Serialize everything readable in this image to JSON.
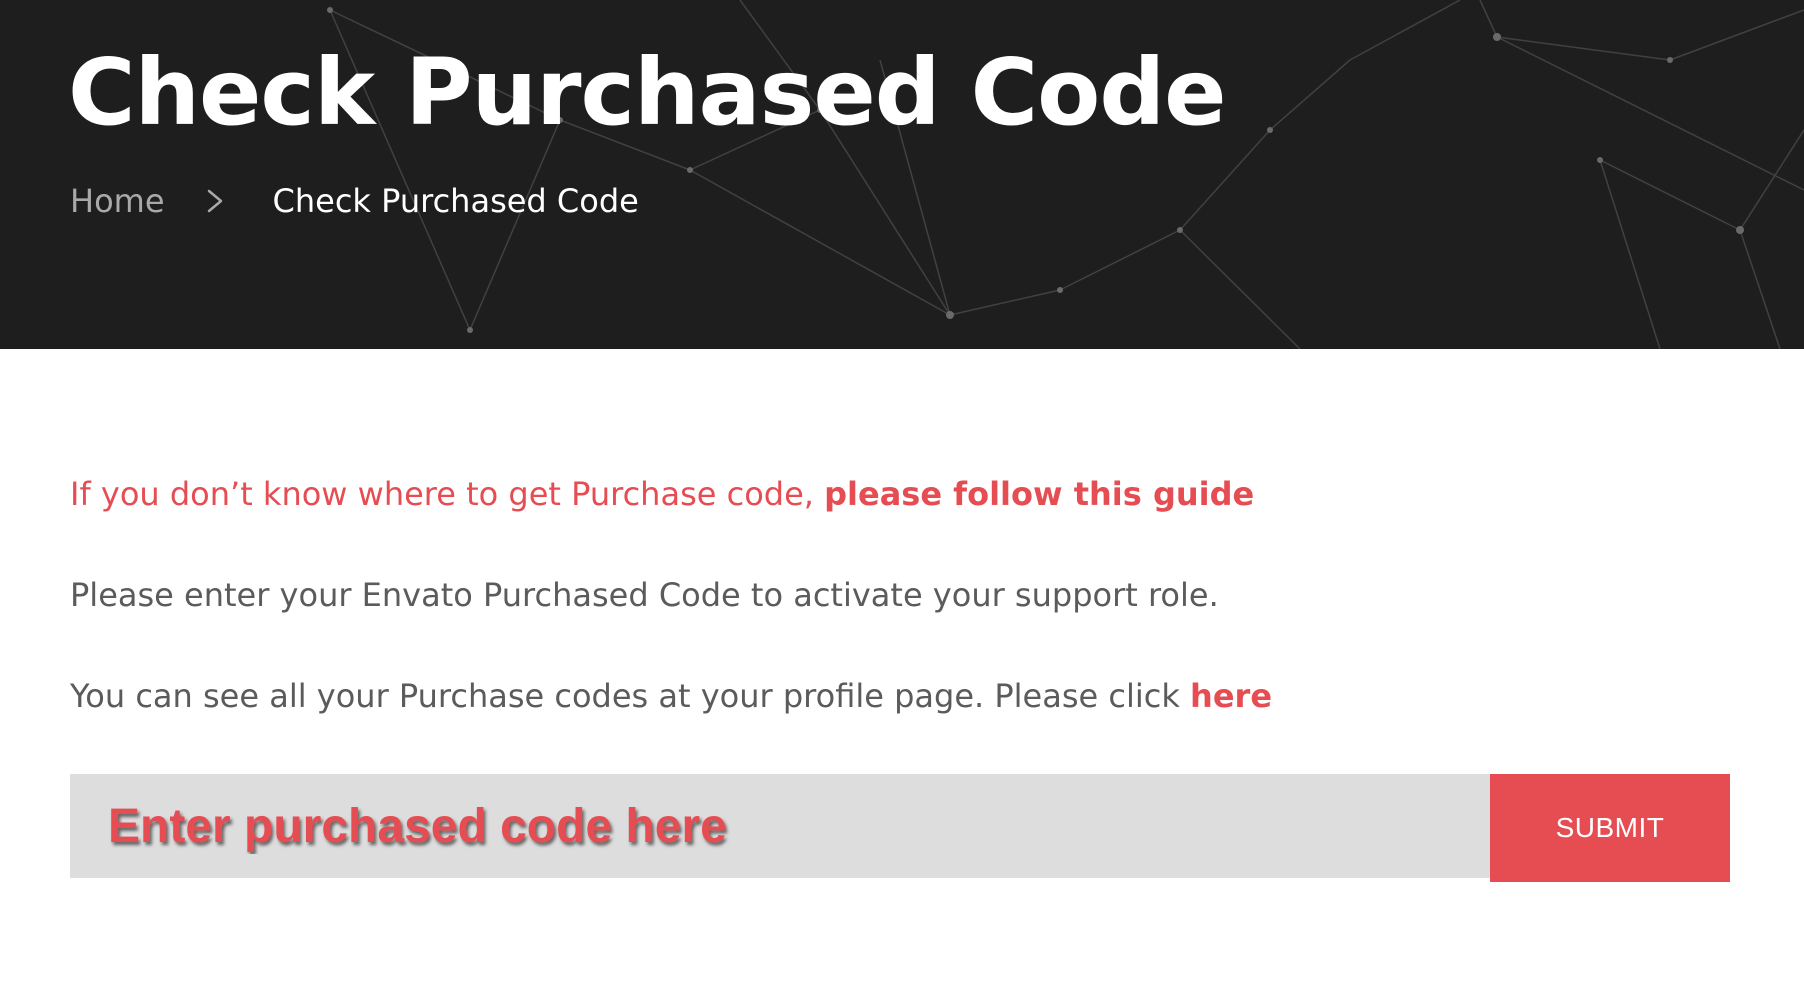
{
  "header": {
    "title": "Check Purchased Code",
    "breadcrumb": {
      "home_label": "Home",
      "separator_icon": "chevron-right-icon",
      "current_label": "Check Purchased Code"
    }
  },
  "main": {
    "guide_text": "If you don’t know where to get Purchase code, ",
    "guide_link": "please follow this guide",
    "instruction_text": "Please enter your Envato Purchased Code to activate your support role.",
    "profile_text": "You can see all your Purchase codes at your profile page. Please click ",
    "profile_link": "here"
  },
  "form": {
    "code_placeholder": "Enter purchased code here",
    "submit_label": "SUBMIT"
  },
  "colors": {
    "accent": "#e64d53",
    "hero_background": "#1e1e1f",
    "input_background": "#dddddd",
    "body_text": "#5b5b5b"
  }
}
